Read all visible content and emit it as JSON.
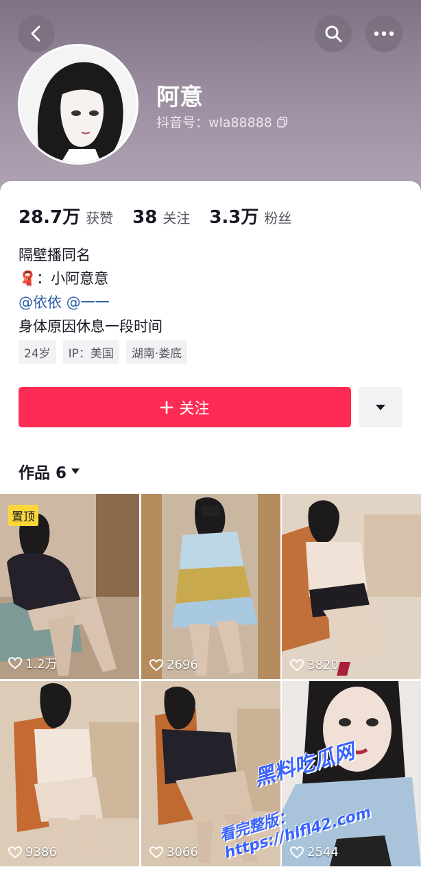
{
  "header": {
    "name": "阿意",
    "douyin_id": "抖音号：wla88888",
    "icons": [
      "back-icon",
      "search-icon",
      "more-icon",
      "copy-icon"
    ]
  },
  "stats": [
    {
      "num": "28.7万",
      "label": "获赞"
    },
    {
      "num": "38",
      "label": "关注"
    },
    {
      "num": "3.3万",
      "label": "粉丝"
    }
  ],
  "bio": {
    "line1": "隔壁播同名",
    "line2_icon": "🧣",
    "line2_text": "：小阿意意",
    "mentions": "@依依 @一一",
    "line4": "身体原因休息一段时间"
  },
  "tags": [
    "24岁",
    "IP：美国",
    "湖南·娄底"
  ],
  "actions": {
    "follow_label": "关注",
    "follow_icon": "plus-icon",
    "more_icon": "triangle-down-icon"
  },
  "works": {
    "title": "作品 6"
  },
  "videos": [
    {
      "likes": "1.2万",
      "pinned": true,
      "pin_label": "置顶"
    },
    {
      "likes": "2696"
    },
    {
      "likes": "3820"
    },
    {
      "likes": "9386"
    },
    {
      "likes": "3066"
    },
    {
      "likes": "2544"
    }
  ],
  "watermark": {
    "line1": "黑料吃瓜网",
    "line2": "看完整版：https://hlfl42.com"
  },
  "colors": {
    "accent": "#fe2c55",
    "header_bg": "#8e8294",
    "pin_bg": "#fdd63a",
    "mention": "#2b5ca8"
  }
}
